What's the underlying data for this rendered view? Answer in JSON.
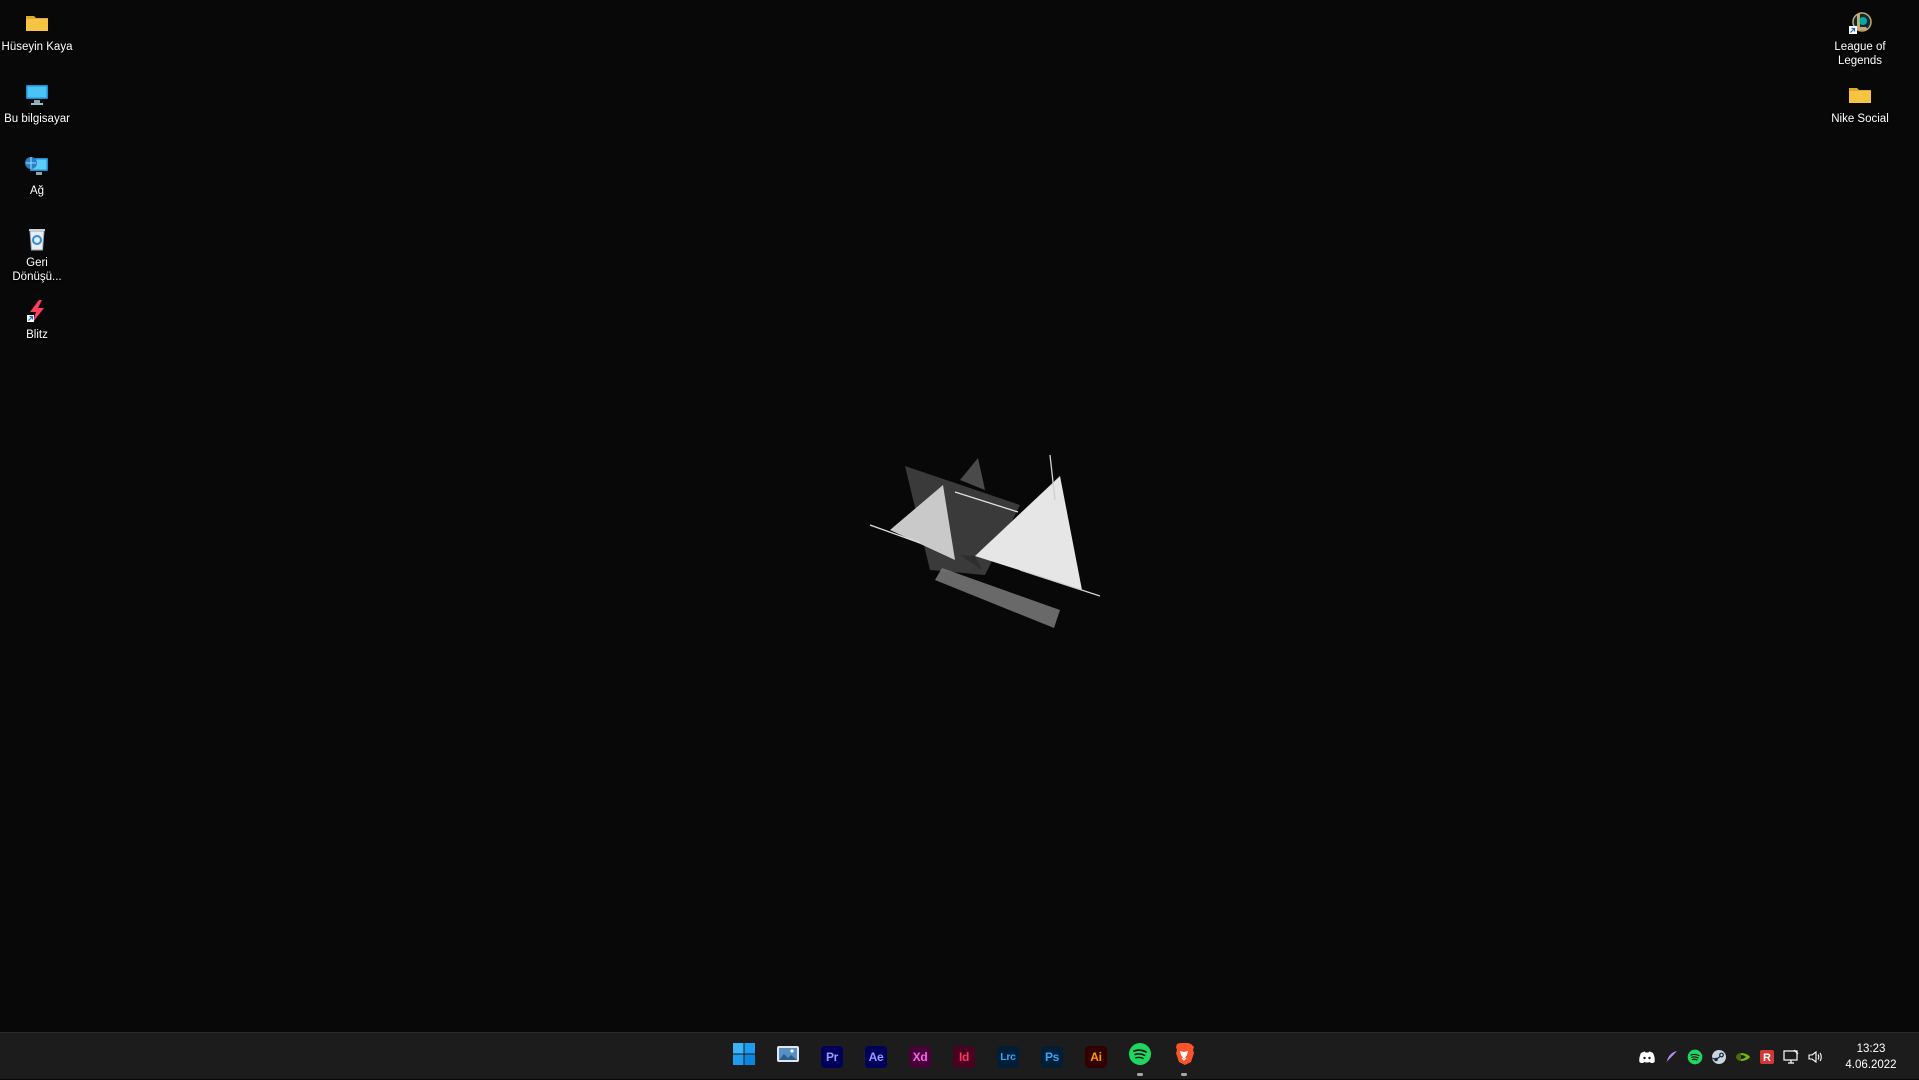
{
  "desktop": {
    "left_icons": [
      {
        "label": "Hüseyin Kaya",
        "icon": "folder-icon"
      },
      {
        "label": "Bu bilgisayar",
        "icon": "computer-icon"
      },
      {
        "label": "Ağ",
        "icon": "network-icon"
      },
      {
        "label": "Geri Dönüşü...",
        "icon": "recycle-bin-icon"
      },
      {
        "label": "Blitz",
        "icon": "blitz-icon"
      }
    ],
    "right_icons": [
      {
        "label": "League of Legends",
        "icon": "league-of-legends-icon"
      },
      {
        "label": "Nike Social",
        "icon": "folder-icon"
      }
    ]
  },
  "taskbar": {
    "apps": [
      {
        "id": "start",
        "icon": "windows-start-icon"
      },
      {
        "id": "photos",
        "icon": "photos-icon"
      },
      {
        "id": "premiere",
        "text": "Pr",
        "bg": "#00005b",
        "fg": "#9999ff"
      },
      {
        "id": "after-effects",
        "text": "Ae",
        "bg": "#00005b",
        "fg": "#9999ff"
      },
      {
        "id": "xd",
        "text": "Xd",
        "bg": "#470137",
        "fg": "#ff61f6"
      },
      {
        "id": "indesign",
        "text": "Id",
        "bg": "#49021f",
        "fg": "#ff3366"
      },
      {
        "id": "lightroom-classic",
        "text": "Lrc",
        "bg": "#001e36",
        "fg": "#31a8ff"
      },
      {
        "id": "photoshop",
        "text": "Ps",
        "bg": "#001e36",
        "fg": "#31a8ff"
      },
      {
        "id": "illustrator",
        "text": "Ai",
        "bg": "#330000",
        "fg": "#ff9a00"
      },
      {
        "id": "spotify",
        "icon": "spotify-icon",
        "running": true
      },
      {
        "id": "brave",
        "icon": "brave-icon",
        "running": true
      }
    ],
    "tray": {
      "icons": [
        "discord-icon",
        "feather-icon",
        "spotify-icon",
        "steam-icon",
        "nvidia-icon",
        "riot-icon",
        "network-monitor-icon",
        "volume-icon"
      ],
      "time": "13:23",
      "date": "4.06.2022"
    }
  },
  "colors": {
    "desktop_bg": "#080808",
    "taskbar_bg": "#1c1c1c",
    "folder": "#f6c443",
    "spotify": "#1ed760",
    "brave": "#fb542b",
    "windows_blue": "#0a9bf5"
  }
}
